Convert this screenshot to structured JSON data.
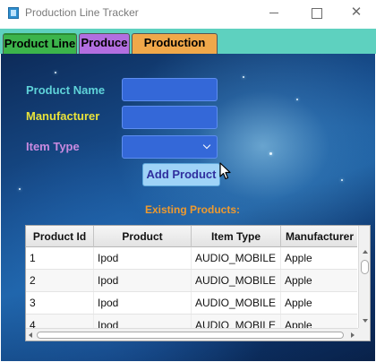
{
  "window": {
    "title": "Production Line Tracker"
  },
  "tabs": [
    {
      "label": "Product Line",
      "color": "#3cb44b"
    },
    {
      "label": "Produce",
      "color": "#b26ee0"
    },
    {
      "label": "Production Log",
      "color": "#f0a84a"
    }
  ],
  "form": {
    "product_name_label": "Product Name",
    "manufacturer_label": "Manufacturer",
    "item_type_label": "Item Type",
    "product_name_value": "",
    "manufacturer_value": "",
    "item_type_value": "",
    "add_button": "Add Product"
  },
  "existing_label": "Existing Products:",
  "table": {
    "columns": [
      "Product Id",
      "Product",
      "Item Type",
      "Manufacturer"
    ],
    "rows": [
      [
        "1",
        "Ipod",
        "AUDIO_MOBILE",
        "Apple"
      ],
      [
        "2",
        "Ipod",
        "AUDIO_MOBILE",
        "Apple"
      ],
      [
        "3",
        "Ipod",
        "AUDIO_MOBILE",
        "Apple"
      ],
      [
        "4",
        "Ipod",
        "AUDIO_MOBILE",
        "Apple"
      ]
    ]
  },
  "colors": {
    "tab_bar": "#5ed1bf",
    "field_bg": "#3468d8",
    "button_bg": "#9fd3f7"
  }
}
